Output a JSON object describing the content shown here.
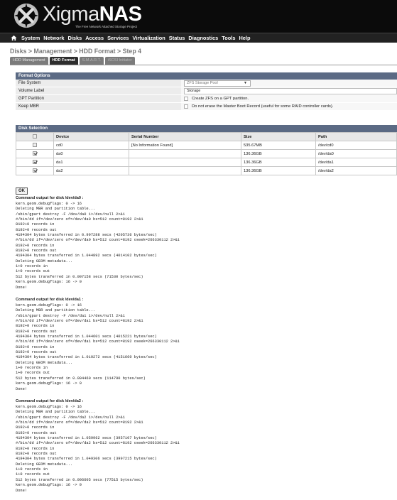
{
  "header": {
    "logo_text_a": "Xigma",
    "logo_text_b": "NAS",
    "tagline": "The Free Network Attached Storage Project"
  },
  "menu": [
    "System",
    "Network",
    "Disks",
    "Access",
    "Services",
    "Virtualization",
    "Status",
    "Diagnostics",
    "Tools",
    "Help"
  ],
  "breadcrumb": "Disks > Management > HDD Format > Step 4",
  "tabs": [
    {
      "label": "HDD Management",
      "state": "normal"
    },
    {
      "label": "HDD Format",
      "state": "active"
    },
    {
      "label": "S.M.A.R.T.",
      "state": "dim"
    },
    {
      "label": "iSCSI Initiator",
      "state": "dim"
    }
  ],
  "format_options": {
    "title": "Format Options",
    "file_system_label": "File System",
    "file_system_value": "ZFS Storage Pool",
    "volume_label_label": "Volume Label",
    "volume_label_value": "Storage",
    "gpt_label": "GPT Partition",
    "gpt_text": "Create ZFS on a GPT partition.",
    "mbr_label": "Keep MBR",
    "mbr_text": "Do not erase the Master Boot Record (useful for some RAID controller cards)."
  },
  "disk_selection": {
    "title": "Disk Selection",
    "headers": [
      "Device",
      "Serial Number",
      "Size",
      "Path"
    ],
    "rows": [
      {
        "device": "cd0",
        "serial": "[No Information Found]",
        "size": "535.67MB",
        "path": "/dev/cd0",
        "checked": false
      },
      {
        "device": "da0",
        "serial": "",
        "size": "136.36GB",
        "path": "/dev/da0",
        "checked": true
      },
      {
        "device": "da1",
        "serial": "",
        "size": "136.36GB",
        "path": "/dev/da1",
        "checked": true
      },
      {
        "device": "da2",
        "serial": "",
        "size": "136.36GB",
        "path": "/dev/da2",
        "checked": true
      }
    ]
  },
  "ok_label": "OK",
  "outputs": [
    {
      "title": "Command output for disk /dev/da0 :",
      "text": "kern.geom.debugflags: 0 -> 16\nDeleting MBR and partition table...\n/sbin/gpart destroy -F /dev/da0 1>/dev/null 2>&1\n#/bin/dd if=/dev/zero of=/dev/da0 bs=512 count=8192 2>&1\n8192+0 records in\n8192+0 records out\n4194304 bytes transferred in 0.997288 secs (4205736 bytes/sec)\n#/bin/dd if=/dev/zero of=/dev/da0 bs=512 count=8192 oseek=266330112 2>&1\n8192+0 records in\n8192+0 records out\n4194304 bytes transferred in 1.044892 secs (4014102 bytes/sec)\nDeleting GEOM metadata...\n1+0 records in\n1+0 records out\n512 bytes transferred in 0.007158 secs (71530 bytes/sec)\nkern.geom.debugflags: 16 -> 0\nDone!"
    },
    {
      "title": "Command output for disk /dev/da1 :",
      "text": "kern.geom.debugflags: 0 -> 16\nDeleting MBR and partition table...\n/sbin/gpart destroy -F /dev/da1 1>/dev/null 2>&1\n#/bin/dd if=/dev/zero of=/dev/da1 bs=512 count=8192 2>&1\n8192+0 records in\n8192+0 records out\n4194304 bytes transferred in 1.044601 secs (4015221 bytes/sec)\n#/bin/dd if=/dev/zero of=/dev/da1 bs=512 count=8192 oseek=266330112 2>&1\n8192+0 records in\n8192+0 records out\n4194304 bytes transferred in 1.010272 secs (4151660 bytes/sec)\nDeleting GEOM metadata...\n1+0 records in\n1+0 records out\n512 bytes transferred in 0.004460 secs (114790 bytes/sec)\nkern.geom.debugflags: 16 -> 0\nDone!"
    },
    {
      "title": "Command output for disk /dev/da2 :",
      "text": "kern.geom.debugflags: 0 -> 16\nDeleting MBR and partition table...\n/sbin/gpart destroy -F /dev/da2 1>/dev/null 2>&1\n#/bin/dd if=/dev/zero of=/dev/da2 bs=512 count=8192 2>&1\n8192+0 records in\n8192+0 records out\n4194304 bytes transferred in 1.059962 secs (3957107 bytes/sec)\n#/bin/dd if=/dev/zero of=/dev/da2 bs=512 count=8192 oseek=266330112 2>&1\n8192+0 records in\n8192+0 records out\n4194304 bytes transferred in 1.049306 secs (3997215 bytes/sec)\nDeleting GEOM metadata...\n1+0 records in\n1+0 records out\n512 bytes transferred in 0.006605 secs (77515 bytes/sec)\nkern.geom.debugflags: 16 -> 0\nDone!"
    }
  ]
}
